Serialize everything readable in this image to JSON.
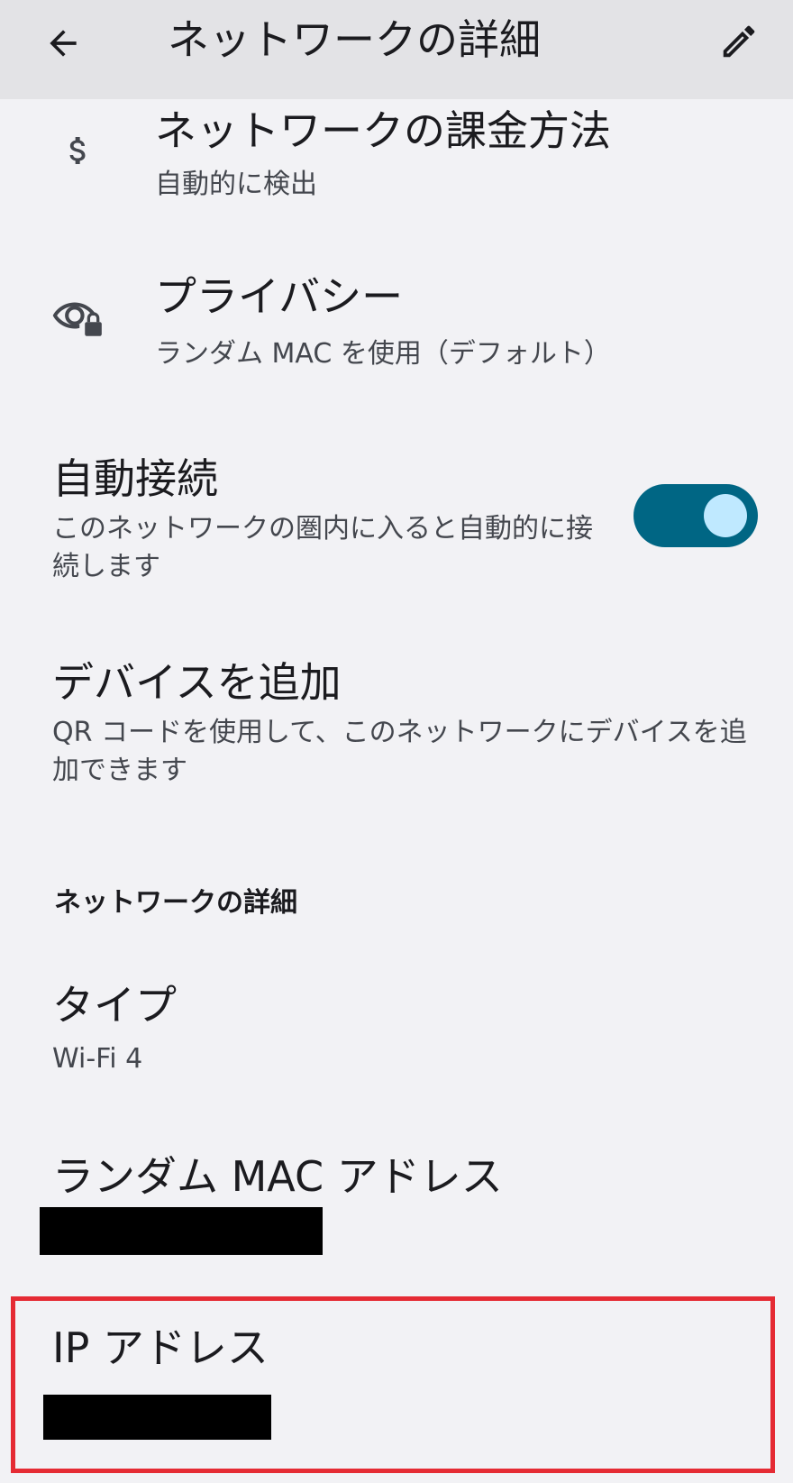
{
  "header": {
    "title": "ネットワークの詳細"
  },
  "items": [
    {
      "title": "ネットワークの課金方法",
      "subtitle": "自動的に検出"
    },
    {
      "title": "プライバシー",
      "subtitle": "ランダム MAC を使用（デフォルト）"
    },
    {
      "title": "自動接続",
      "subtitle": "このネットワークの圏内に入ると自動的に接続します",
      "toggle_on": true
    },
    {
      "title": "デバイスを追加",
      "subtitle": "QR コードを使用して、このネットワークにデバイスを追加できます"
    }
  ],
  "details_section": {
    "header": "ネットワークの詳細",
    "type": {
      "label": "タイプ",
      "value": "Wi-Fi 4"
    },
    "mac": {
      "label": "ランダム MAC アドレス"
    },
    "ip": {
      "label": "IP アドレス"
    }
  },
  "colors": {
    "toggle_track": "#006684",
    "toggle_thumb": "#bfe9ff",
    "highlight": "#e52b34"
  }
}
